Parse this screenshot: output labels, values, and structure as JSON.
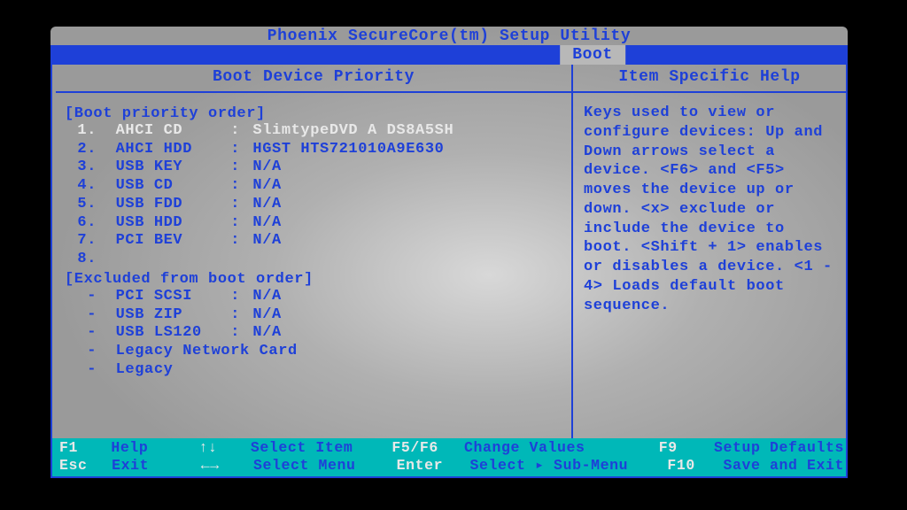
{
  "title": "Phoenix SecureCore(tm) Setup Utility",
  "tab": "Boot",
  "left": {
    "heading": "Boot Device Priority",
    "order_label": "[Boot priority order]",
    "items": [
      {
        "idx": "1.",
        "dev": "AHCI CD",
        "val": "SlimtypeDVD A DS8A5SH",
        "selected": true
      },
      {
        "idx": "2.",
        "dev": "AHCI HDD",
        "val": "HGST HTS721010A9E630",
        "selected": false
      },
      {
        "idx": "3.",
        "dev": "USB KEY",
        "val": "N/A",
        "selected": false
      },
      {
        "idx": "4.",
        "dev": "USB CD",
        "val": "N/A",
        "selected": false
      },
      {
        "idx": "5.",
        "dev": "USB FDD",
        "val": "N/A",
        "selected": false
      },
      {
        "idx": "6.",
        "dev": "USB HDD",
        "val": "N/A",
        "selected": false
      },
      {
        "idx": "7.",
        "dev": "PCI BEV",
        "val": "N/A",
        "selected": false
      },
      {
        "idx": "8.",
        "dev": "",
        "val": "",
        "selected": false
      }
    ],
    "excluded_label": "[Excluded from boot order]",
    "excluded": [
      {
        "idx": " -",
        "dev": "PCI SCSI",
        "val": "N/A"
      },
      {
        "idx": " -",
        "dev": "USB ZIP",
        "val": "N/A"
      },
      {
        "idx": " -",
        "dev": "USB LS120",
        "val": "N/A"
      },
      {
        "idx": " -",
        "dev": "Legacy Network Card",
        "val": ""
      },
      {
        "idx": " -",
        "dev": "Legacy",
        "val": ""
      }
    ]
  },
  "right": {
    "heading": "Item Specific Help",
    "text": "Keys used to view or configure devices: Up and Down arrows select a device. <F6> and <F5> moves the device up or down. <x> exclude or include the device to boot. <Shift + 1> enables or disables a device. <1 - 4> Loads default boot sequence."
  },
  "footer": {
    "row1": {
      "k1": "F1",
      "l1": "Help",
      "k2": "↑↓",
      "l2": "Select Item",
      "k3": "F5/F6",
      "l3": "Change Values",
      "k4": "F9",
      "l4": "Setup Defaults"
    },
    "row2": {
      "k1": "Esc",
      "l1": "Exit",
      "k2": "←→",
      "l2": "Select Menu",
      "k3": "Enter",
      "l3": "Select ▸ Sub-Menu",
      "k4": "F10",
      "l4": "Save and Exit"
    }
  }
}
